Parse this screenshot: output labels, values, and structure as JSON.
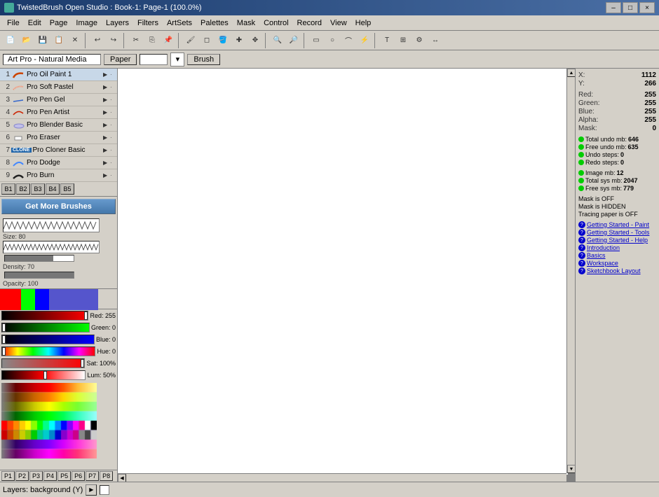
{
  "app": {
    "title": "TwistedBrush Open Studio : Book-1: Page-1 (100.0%)",
    "icon": "TB"
  },
  "title_controls": {
    "minimize": "–",
    "maximize": "□",
    "close": "×"
  },
  "menu": {
    "items": [
      "File",
      "Edit",
      "Page",
      "Image",
      "Layers",
      "Filters",
      "ArtSets",
      "Palettes",
      "Mask",
      "Control",
      "Record",
      "View",
      "Help"
    ]
  },
  "toolbar2": {
    "art_pro_label": "Art Pro - Natural Media",
    "paper_label": "Paper",
    "paper_value": "",
    "brush_label": "Brush"
  },
  "brushes": [
    {
      "num": "1",
      "name": "Pro Oil Paint 1",
      "has_arrow": true
    },
    {
      "num": "2",
      "name": "Pro Soft Pastel",
      "has_arrow": true
    },
    {
      "num": "3",
      "name": "Pro Pen Gel",
      "has_arrow": true
    },
    {
      "num": "4",
      "name": "Pro Pen Artist",
      "has_arrow": true
    },
    {
      "num": "5",
      "name": "Pro Blender Basic",
      "has_arrow": true
    },
    {
      "num": "6",
      "name": "Pro Eraser",
      "has_arrow": true
    },
    {
      "num": "7",
      "name": "Pro Cloner Basic",
      "has_arrow": true,
      "badge": "CLONE"
    },
    {
      "num": "8",
      "name": "Pro Dodge",
      "has_arrow": true
    },
    {
      "num": "9",
      "name": "Pro Burn",
      "has_arrow": true
    }
  ],
  "b_buttons": [
    "B1",
    "B2",
    "B3",
    "B4",
    "B5"
  ],
  "more_brushes": "Get More Brushes",
  "brush_size": {
    "label": "Size: 80",
    "value": 80,
    "max": 100
  },
  "brush_density": {
    "label": "Density: 70",
    "value": 70,
    "max": 100
  },
  "brush_opacity": {
    "label": "Opacity: 100",
    "value": 100,
    "max": 100
  },
  "color_values": {
    "red_label": "Red: 255",
    "green_label": "Green: 0",
    "blue_label": "Blue: 0",
    "hue_label": "Hue: 0",
    "sat_label": "Sat: 100%",
    "lum_label": "Lum: 50%",
    "red": 255,
    "green": 0,
    "blue": 0
  },
  "palette_presets": [
    "P1",
    "P2",
    "P3",
    "P4",
    "P5",
    "P6",
    "P7",
    "P8"
  ],
  "info": {
    "x_label": "X:",
    "x_value": "1112",
    "y_label": "Y:",
    "y_value": "266",
    "red_label": "Red:",
    "red_value": "255",
    "green_label": "Green:",
    "green_value": "255",
    "blue_label": "Blue:",
    "blue_value": "255",
    "alpha_label": "Alpha:",
    "alpha_value": "255",
    "mask_label": "Mask:",
    "mask_value": "0",
    "total_undo_label": "Total undo mb:",
    "total_undo_value": "646",
    "free_undo_label": "Free undo mb:",
    "free_undo_value": "635",
    "undo_steps_label": "Undo steps:",
    "undo_steps_value": "0",
    "redo_steps_label": "Redo steps:",
    "redo_steps_value": "0",
    "image_mb_label": "Image mb:",
    "image_mb_value": "12",
    "total_sys_label": "Total sys mb:",
    "total_sys_value": "2047",
    "free_sys_label": "Free sys mb:",
    "free_sys_value": "779",
    "mask_off": "Mask is OFF",
    "mask_hidden": "Mask is HIDDEN",
    "tracing": "Tracing paper is OFF",
    "link1": "Getting Started - Paint",
    "link2": "Getting Started - Tools",
    "link3": "Getting Started - Help",
    "link4": "Introduction",
    "link5": "Basics",
    "link6": "Workspace",
    "link7": "Sketchbook Layout"
  },
  "status": {
    "layers_label": "Layers: background (Y)"
  },
  "colors": {
    "accent_blue": "#1a3a6b",
    "toolbar_bg": "#d4d0c8",
    "selected_brush": "#c8d8e8"
  }
}
